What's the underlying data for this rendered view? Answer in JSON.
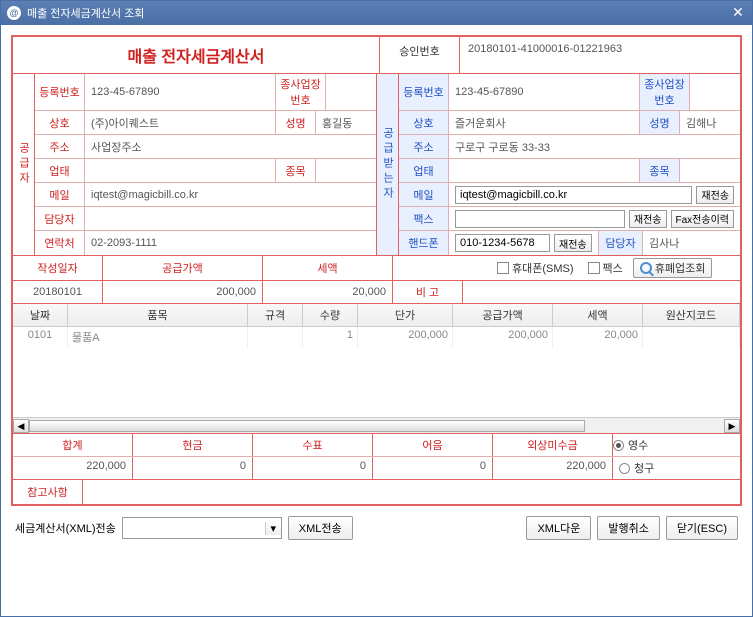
{
  "window": {
    "title": "매출 전자세금계산서 조회"
  },
  "header": {
    "doctitle": "매출 전자세금계산서",
    "approval_label": "승인번호",
    "approval_no": "20180101-41000016-01221963"
  },
  "supplier": {
    "vlabel": "공급자",
    "regno_l": "등록번호",
    "regno": "123-45-67890",
    "subbiz_l": "종사업장번호",
    "subbiz": "",
    "name_l": "상호",
    "name": "(주)아이퀘스트",
    "ceo_l": "성명",
    "ceo": "홍길동",
    "addr_l": "주소",
    "addr": "사업장주소",
    "biztype_l": "업태",
    "biztype": "",
    "bizitem_l": "종목",
    "bizitem": "",
    "email_l": "메일",
    "email": "iqtest@magicbill.co.kr",
    "mgr_l": "담당자",
    "mgr": "",
    "tel_l": "연락처",
    "tel": "02-2093-1111"
  },
  "receiver": {
    "vlabel": "공급받는자",
    "regno_l": "등록번호",
    "regno": "123-45-67890",
    "subbiz_l": "종사업장번호",
    "subbiz": "",
    "name_l": "상호",
    "name": "즐거운회사",
    "ceo_l": "성명",
    "ceo": "김해나",
    "addr_l": "주소",
    "addr": "구로구 구로동 33-33",
    "biztype_l": "업태",
    "biztype": "",
    "bizitem_l": "종목",
    "bizitem": "",
    "email_l": "메일",
    "email": "iqtest@magicbill.co.kr",
    "resend": "재전송",
    "fax_l": "팩스",
    "fax": "",
    "fax_resend": "재전송",
    "fax_hist": "Fax전송이력",
    "phone_l": "핸드폰",
    "phone": "010-1234-5678",
    "phone_resend": "재전송",
    "mgr_l": "담당자",
    "mgr": "김사나"
  },
  "amounts": {
    "date_l": "작성일자",
    "supply_l": "공급가액",
    "tax_l": "세액",
    "sms_chk": "휴대폰(SMS)",
    "fax_chk": "팩스",
    "closed_btn": "휴폐업조회",
    "date": "20180101",
    "supply": "200,000",
    "tax": "20,000",
    "remark_l": "비 고",
    "remark": ""
  },
  "items": {
    "headers": [
      "날짜",
      "품목",
      "규격",
      "수량",
      "단가",
      "공급가액",
      "세액",
      "원산지코드"
    ],
    "rows": [
      {
        "date": "0101",
        "name": "물품A",
        "spec": "",
        "qty": "1",
        "price": "200,000",
        "supply": "200,000",
        "tax": "20,000",
        "origin": ""
      }
    ]
  },
  "totals": {
    "labels": [
      "합계",
      "현금",
      "수표",
      "어음",
      "외상미수금"
    ],
    "values": [
      "220,000",
      "0",
      "0",
      "0",
      "220,000"
    ],
    "receipt": "영수",
    "claim": "청구"
  },
  "note": {
    "label": "참고사항",
    "value": ""
  },
  "bottom": {
    "xml_label": "세금계산서(XML)전송",
    "xml_send": "XML전송",
    "xml_down": "XML다운",
    "cancel": "발행취소",
    "close": "닫기(ESC)"
  }
}
